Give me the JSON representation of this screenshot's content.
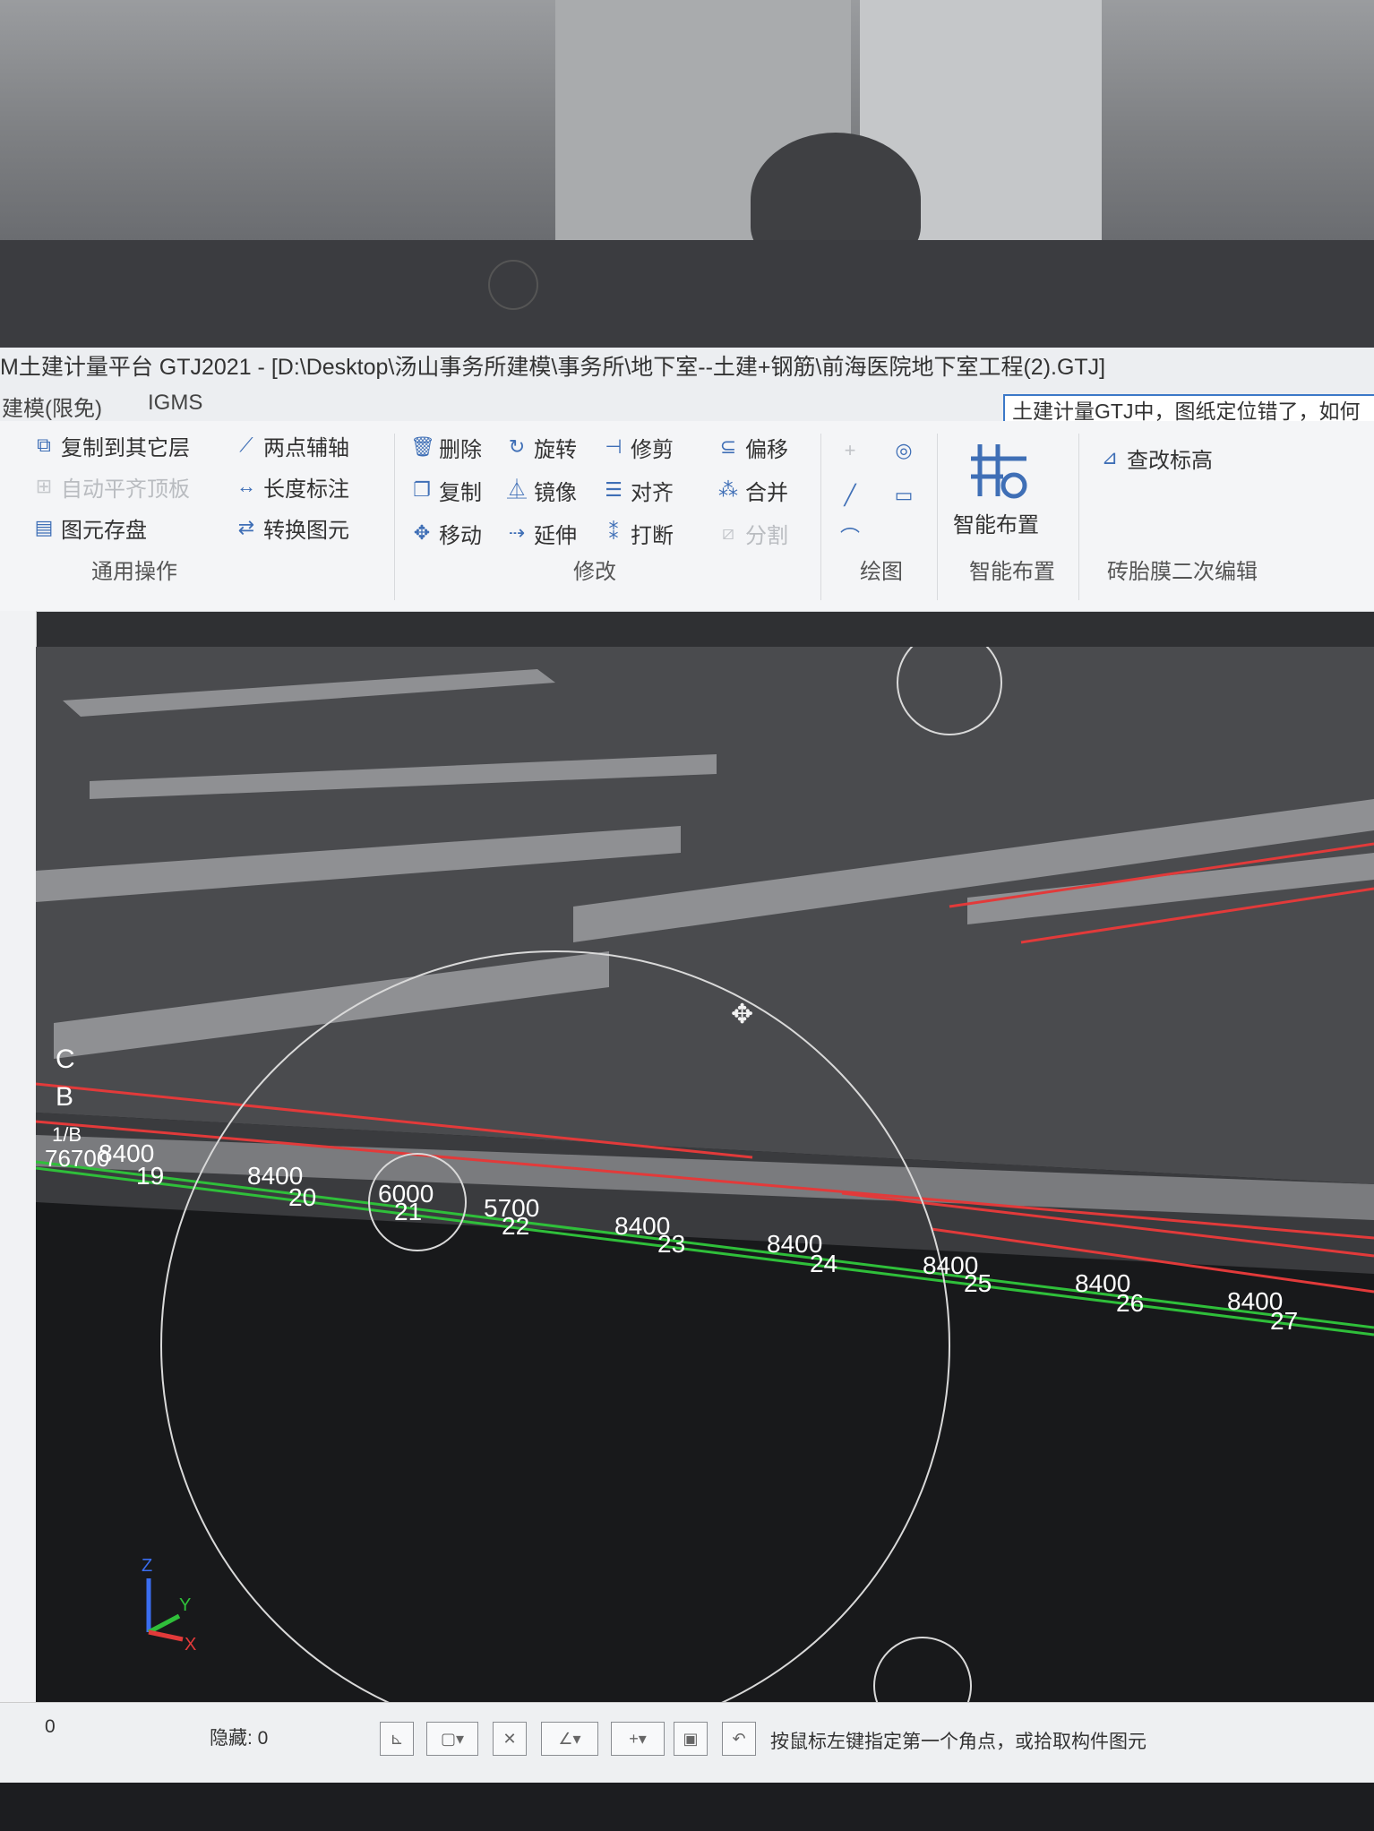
{
  "title_bar": {
    "text": "M土建计量平台 GTJ2021 - [D:\\Desktop\\汤山事务所建模\\事务所\\地下室--土建+钢筋\\前海医院地下室工程(2).GTJ]"
  },
  "menu": {
    "items": [
      "建模(限免)",
      "IGMS"
    ]
  },
  "help_box": {
    "text": "土建计量GTJ中，图纸定位错了，如何"
  },
  "ribbon": {
    "general": {
      "copy_to_floor": "复制到其它层",
      "auto_align_slab": "自动平齐顶板",
      "save_element": "图元存盘",
      "two_point_axis": "两点辅轴",
      "length_dim": "长度标注",
      "convert_element": "转换图元",
      "label": "通用操作"
    },
    "modify": {
      "delete": "删除",
      "rotate": "旋转",
      "trim": "修剪",
      "offset": "偏移",
      "copy": "复制",
      "mirror": "镜像",
      "align": "对齐",
      "merge": "合并",
      "move": "移动",
      "extend": "延伸",
      "break": "打断",
      "split": "分割",
      "label": "修改"
    },
    "draw": {
      "label": "绘图"
    },
    "smart": {
      "button": "智能布置",
      "label": "智能布置"
    },
    "brick": {
      "check_elevation": "查改标高",
      "label": "砖胎膜二次编辑"
    }
  },
  "viewport": {
    "axis_letters": [
      "C",
      "B",
      "1/B"
    ],
    "spans": [
      "8400",
      "8400",
      "6000",
      "5700",
      "8400",
      "8400",
      "8400",
      "8400",
      "8400"
    ],
    "axis_numbers": [
      "19",
      "20",
      "21",
      "22",
      "23",
      "24",
      "25",
      "26",
      "27"
    ],
    "left_label": "76700",
    "coord": {
      "z": "Z",
      "y": "Y",
      "x": "X"
    }
  },
  "status": {
    "left_value": "0",
    "hidden_label": "隐藏: 0",
    "hint": "按鼠标左键指定第一个角点，或拾取构件图元"
  }
}
